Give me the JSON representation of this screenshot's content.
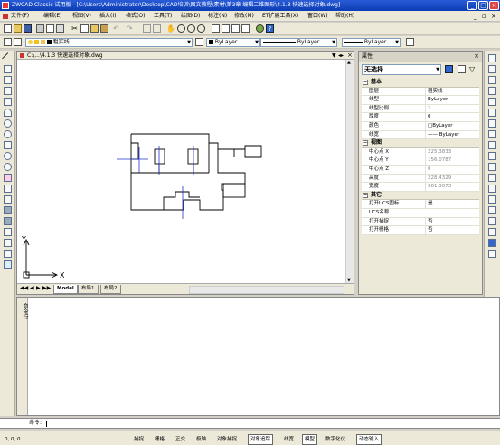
{
  "window": {
    "title": "ZWCAD Classic 试用版 - [C:\\Users\\Administrator\\Desktop\\CAD培训\\图文教程\\素材\\第3章 编辑二维图形\\4.1.3  快速选择对象.dwg]"
  },
  "menu": [
    "文件(F)",
    "编辑(E)",
    "视图(V)",
    "插入(I)",
    "格式(O)",
    "工具(T)",
    "绘图(D)",
    "标注(N)",
    "修改(M)",
    "ET扩展工具(X)",
    "窗口(W)",
    "帮助(H)"
  ],
  "layer_toolbar": {
    "layer": "粗实线",
    "color": "ByLayer",
    "linetype": "ByLayer",
    "lineweight": "ByLayer"
  },
  "document": {
    "tab_title": "C:\\...\\4.1.3  快速选择对象.dwg"
  },
  "layout_tabs": [
    "Model",
    "布局1",
    "布局2"
  ],
  "axes": {
    "y": "Y",
    "x": "X"
  },
  "properties": {
    "panel_title": "属性",
    "selection": "无选择",
    "categories": [
      {
        "name": "基本",
        "rows": [
          {
            "key": "图层",
            "value": "粗实线",
            "grey": false
          },
          {
            "key": "线型",
            "value": "ByLayer",
            "grey": false
          },
          {
            "key": "线型比例",
            "value": "1",
            "grey": false
          },
          {
            "key": "厚度",
            "value": "0",
            "grey": false
          },
          {
            "key": "颜色",
            "value": "□ByLayer",
            "grey": false
          },
          {
            "key": "线宽",
            "value": "—— ByLayer",
            "grey": false
          }
        ]
      },
      {
        "name": "视图",
        "rows": [
          {
            "key": "中心点 X",
            "value": "225.3833",
            "grey": true
          },
          {
            "key": "中心点 Y",
            "value": "156.0787",
            "grey": true
          },
          {
            "key": "中心点 Z",
            "value": "0",
            "grey": true
          },
          {
            "key": "高度",
            "value": "228.4329",
            "grey": true
          },
          {
            "key": "宽度",
            "value": "361.3073",
            "grey": true
          }
        ]
      },
      {
        "name": "其它",
        "rows": [
          {
            "key": "打开UCS图标",
            "value": "是",
            "grey": false
          },
          {
            "key": "UCS名称",
            "value": "",
            "grey": false
          },
          {
            "key": "打开捕捉",
            "value": "否",
            "grey": false
          },
          {
            "key": "打开栅格",
            "value": "否",
            "grey": false
          }
        ]
      }
    ]
  },
  "command": {
    "side_label": "命令行",
    "prompt": "命令:"
  },
  "status": {
    "coords": "0, 0, 0",
    "buttons": [
      {
        "label": "捕捉",
        "on": false
      },
      {
        "label": "栅格",
        "on": false
      },
      {
        "label": "正交",
        "on": false
      },
      {
        "label": "极轴",
        "on": false
      },
      {
        "label": "对象捕捉",
        "on": false
      },
      {
        "label": "对象追踪",
        "on": true
      },
      {
        "label": "线宽",
        "on": false
      },
      {
        "label": "模型",
        "on": true
      },
      {
        "label": "数字化仪",
        "on": false
      },
      {
        "label": "动态输入",
        "on": true
      }
    ]
  },
  "colors": {
    "title_bar": "#0a3db3",
    "center_line": "#2233cc",
    "drawing_line": "#000000"
  }
}
